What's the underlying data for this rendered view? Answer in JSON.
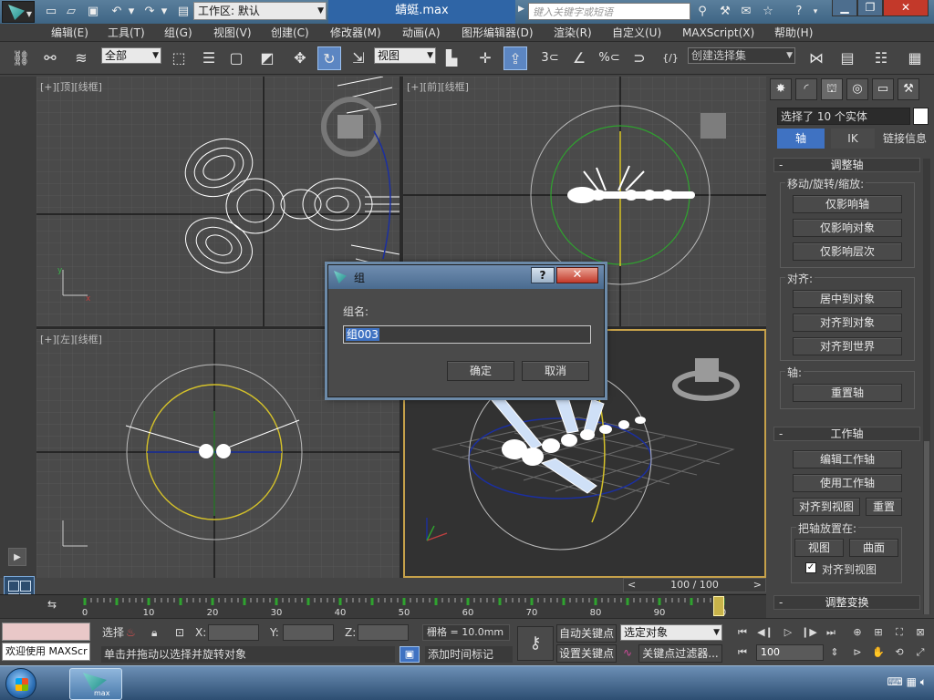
{
  "titlebar": {
    "workspace_label": "工作区: 默认",
    "document_title": "蜻蜓.max",
    "search_placeholder": "键入关键字或短语"
  },
  "menu": [
    "编辑(E)",
    "工具(T)",
    "组(G)",
    "视图(V)",
    "创建(C)",
    "修改器(M)",
    "动画(A)",
    "图形编辑器(D)",
    "渲染(R)",
    "自定义(U)",
    "MAXScript(X)",
    "帮助(H)"
  ],
  "toolbar": {
    "filter_value": "全部",
    "refcoord_value": "视图",
    "named_selection_placeholder": "创建选择集",
    "snap_labels": [
      "3",
      "%"
    ]
  },
  "viewports": {
    "top": {
      "label": "[+][顶][线框]"
    },
    "front": {
      "label": "[+][前][线框]"
    },
    "left": {
      "label": "[+][左][线框]"
    },
    "perspective": {
      "label": ""
    }
  },
  "command_panel": {
    "selection_text": "选择了 10 个实体",
    "subtabs": [
      "轴",
      "IK",
      "链接信息"
    ],
    "adjust_pivot": {
      "title": "调整轴",
      "move_group": "移动/旋转/缩放:",
      "buttons": [
        "仅影响轴",
        "仅影响对象",
        "仅影响层次"
      ],
      "align_group": "对齐:",
      "align_buttons": [
        "居中到对象",
        "对齐到对象",
        "对齐到世界"
      ],
      "pivot_group": "轴:",
      "reset_pivot": "重置轴"
    },
    "working_pivot": {
      "title": "工作轴",
      "edit": "编辑工作轴",
      "use": "使用工作轴",
      "align_to_view": "对齐到视图",
      "reset": "重置",
      "place_group": "把轴放置在:",
      "view": "视图",
      "surface": "曲面",
      "checkbox_label": "对齐到视图",
      "checkbox_checked": true
    },
    "adjust_transform_title": "调整变换"
  },
  "timeline": {
    "frame_counter": "100 / 100",
    "ticks": [
      "0",
      "10",
      "20",
      "30",
      "40",
      "50",
      "60",
      "70",
      "80",
      "90",
      "100"
    ],
    "current_frame": 100
  },
  "statusbar": {
    "maxscript_text": "欢迎使用 MAXScr",
    "select_label": "选择",
    "x_label": "X:",
    "y_label": "Y:",
    "z_label": "Z:",
    "grid_label": "栅格 = 10.0mm",
    "status_message": "单击并拖动以选择并旋转对象",
    "add_time_tag": "添加时间标记",
    "auto_key": "自动关键点",
    "set_key": "设置关键点",
    "key_filter_dropdown": "选定对象",
    "key_filters": "关键点过滤器...",
    "frame_value": "100"
  },
  "dialog": {
    "title": "组",
    "help_label": "?",
    "label": "组名:",
    "input_value": "组003",
    "ok": "确定",
    "cancel": "取消"
  },
  "taskbar": {
    "app_label": "max"
  }
}
